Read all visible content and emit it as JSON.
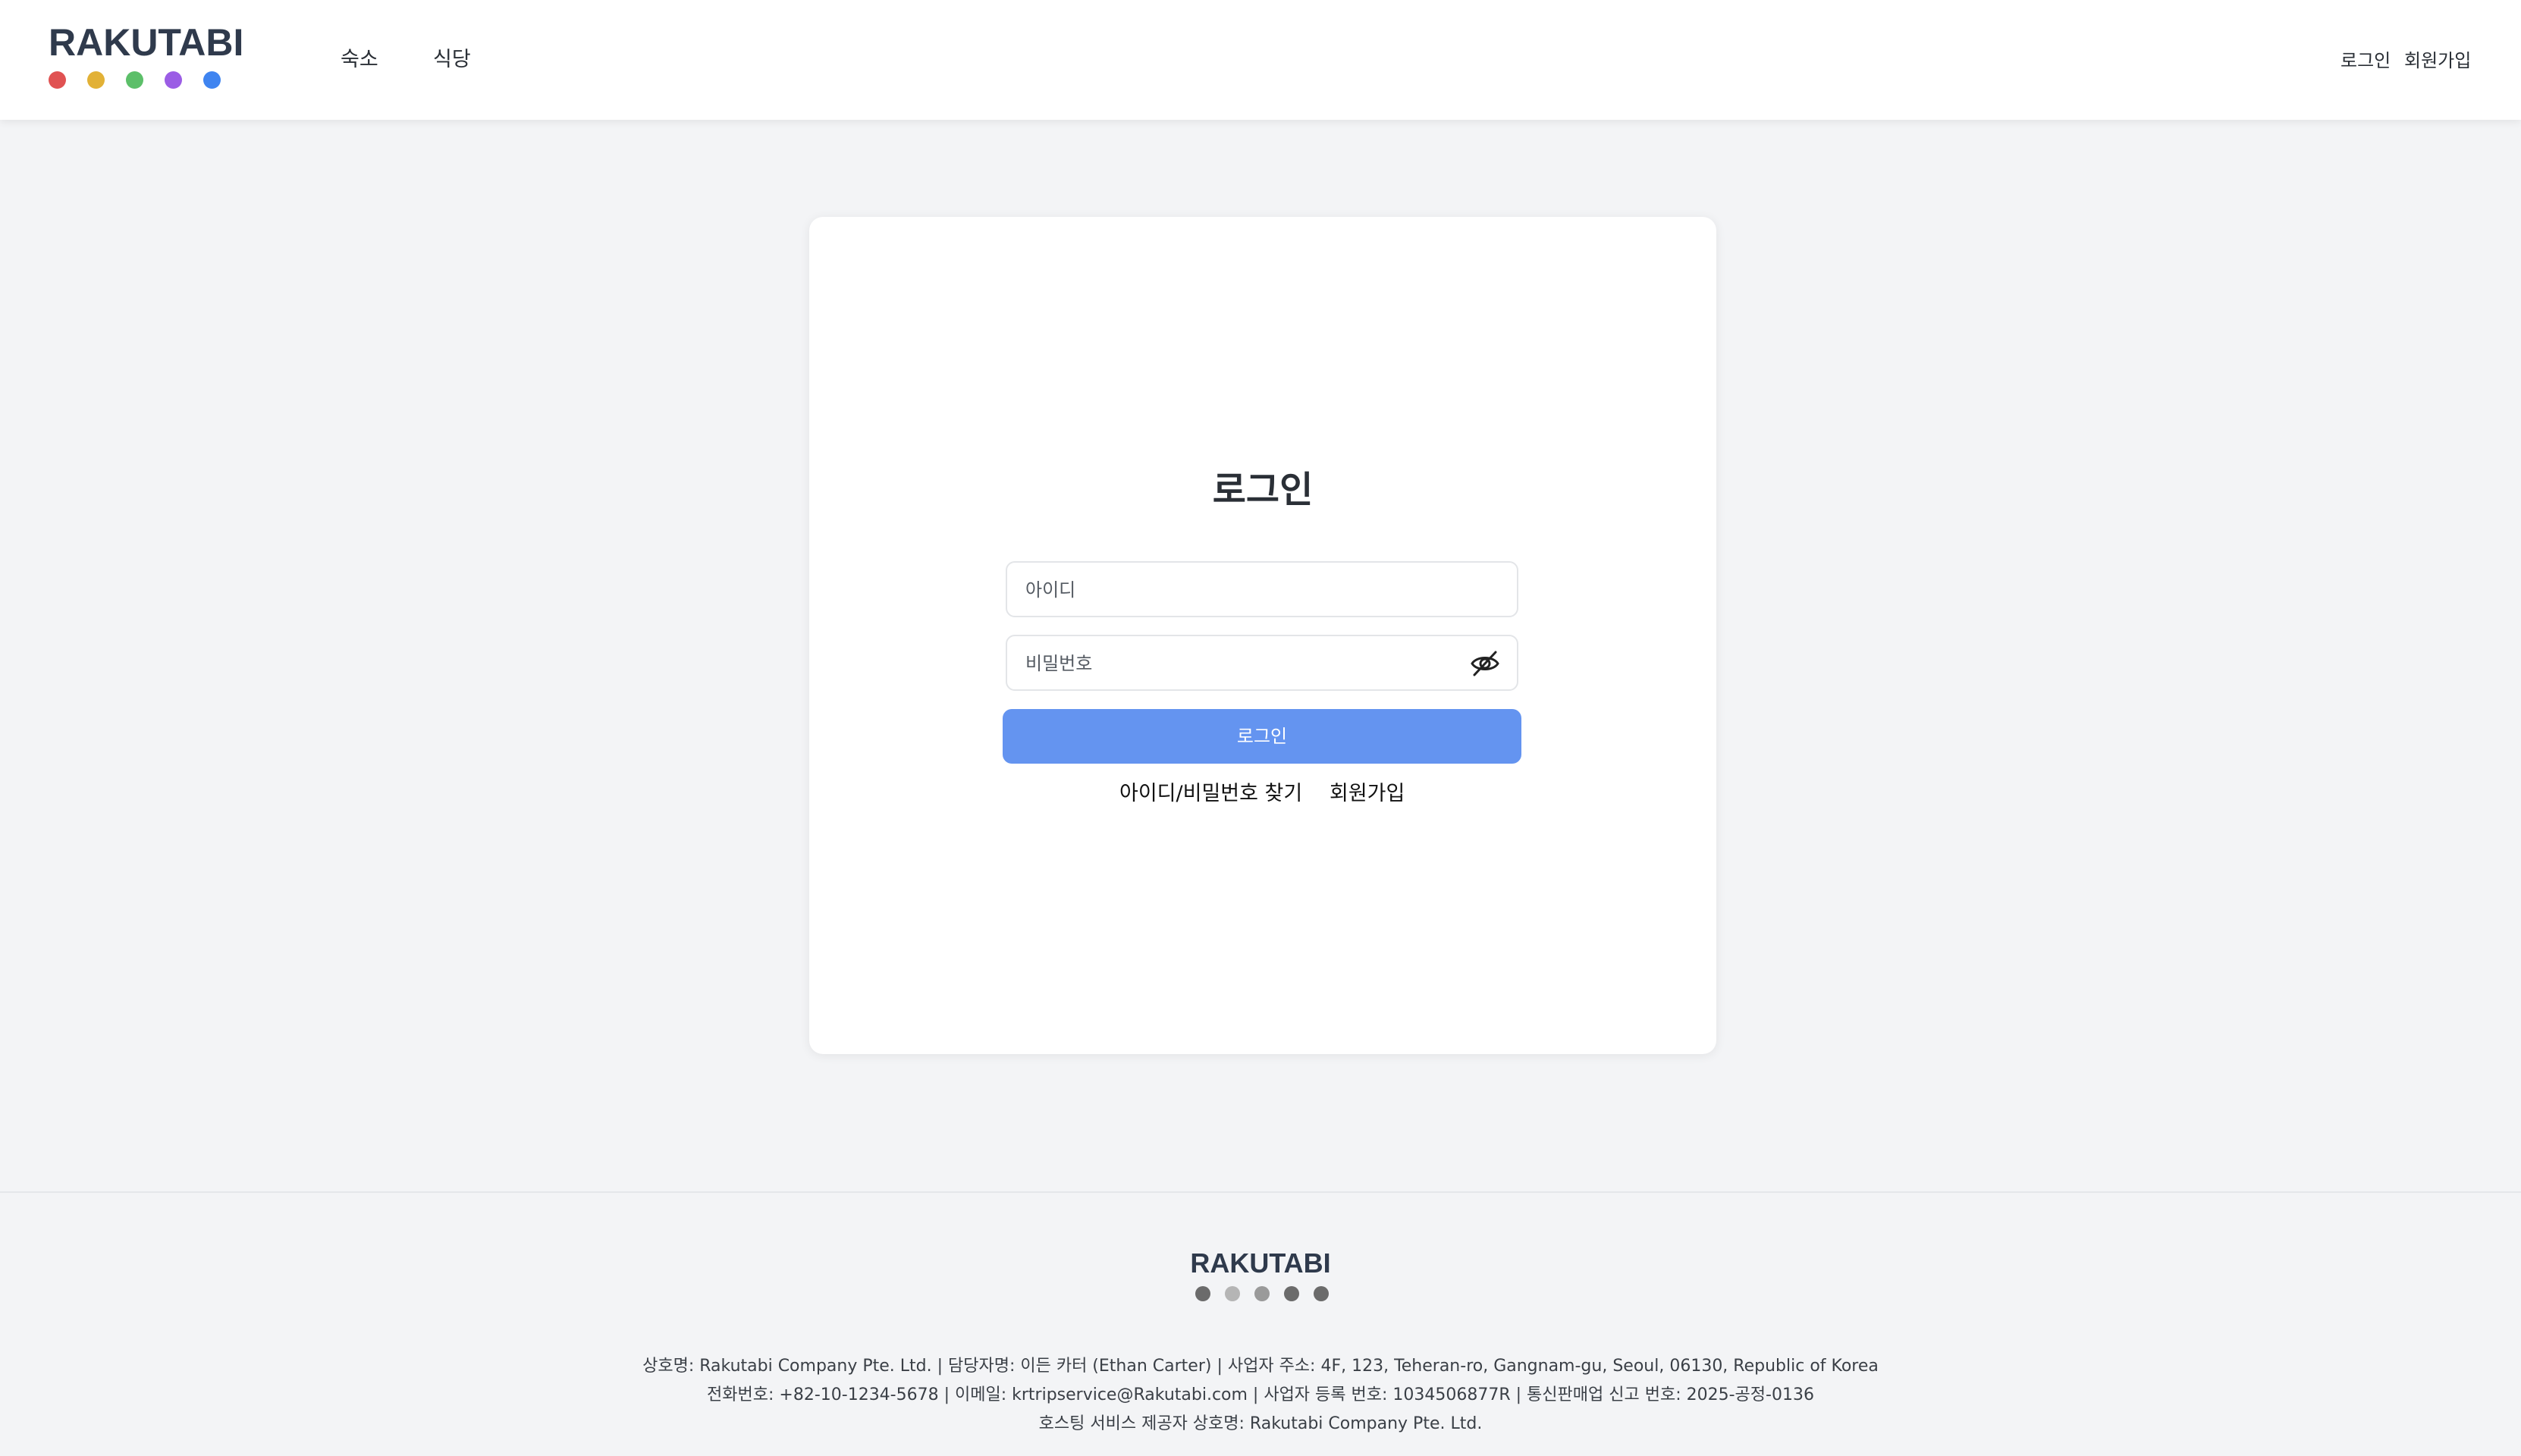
{
  "header": {
    "logo_text": "RAKUTABI",
    "logo_dots": [
      "#e05252",
      "#e2b136",
      "#5cbf69",
      "#9b5de5",
      "#3f84f0"
    ],
    "nav": [
      {
        "label": "숙소"
      },
      {
        "label": "식당"
      }
    ],
    "auth": {
      "login": "로그인",
      "signup": "회원가입"
    }
  },
  "login_card": {
    "title": "로그인",
    "id_placeholder": "아이디",
    "password_placeholder": "비밀번호",
    "submit_label": "로그인",
    "find_account_link": "아이디/비밀번호 찾기",
    "signup_link": "회원가입"
  },
  "footer": {
    "logo_text": "RAKUTABI",
    "logo_dots": [
      "#6b6b6b",
      "#b5b5b5",
      "#9a9a9a",
      "#6b6b6b",
      "#6b6b6b"
    ],
    "lines": [
      "상호명: Rakutabi Company Pte. Ltd. | 담당자명: 이든 카터 (Ethan Carter) | 사업자 주소: 4F, 123, Teheran-ro, Gangnam-gu, Seoul, 06130, Republic of Korea",
      "전화번호: +82-10-1234-5678 | 이메일: krtripservice@Rakutabi.com | 사업자 등록 번호: 1034506877R | 통신판매업 신고 번호: 2025-공정-0136",
      "호스팅 서비스 제공자 상호명: Rakutabi Company Pte. Ltd."
    ]
  },
  "colors": {
    "accent_button": "#6494f0",
    "page_background": "#f3f4f6"
  }
}
